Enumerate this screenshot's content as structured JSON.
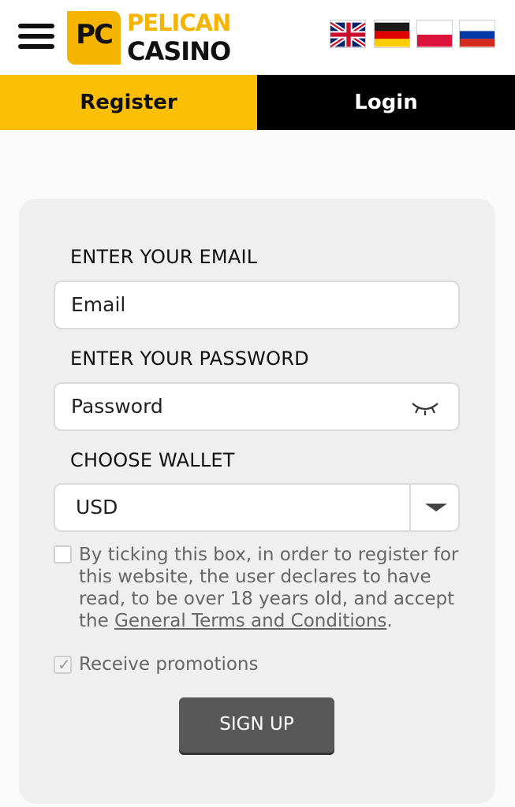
{
  "header": {
    "logo": {
      "badge": "PC",
      "line1": "PELICAN",
      "line2": "CASINO"
    },
    "flags": [
      {
        "name": "uk-flag-icon"
      },
      {
        "name": "germany-flag-icon"
      },
      {
        "name": "poland-flag-icon"
      },
      {
        "name": "russia-flag-icon"
      }
    ]
  },
  "tabs": {
    "register": "Register",
    "login": "Login"
  },
  "form": {
    "email_label": "ENTER YOUR EMAIL",
    "email_placeholder": "Email",
    "password_label": "ENTER YOUR PASSWORD",
    "password_placeholder": "Password",
    "wallet_label": "CHOOSE WALLET",
    "wallet_value": "USD",
    "terms_text": "By ticking this box, in order to register for this website, the user declares to have read, to be over 18 years old, and accept the ",
    "terms_link": "General Terms and Conditions",
    "terms_end": ".",
    "terms_checked": false,
    "promo_label": "Receive promotions",
    "promo_checked": true,
    "signup_label": "SIGN UP"
  },
  "colors": {
    "brand_yellow": "#fbbf05",
    "logo_yellow": "#f4b400",
    "tab_dark": "#000000",
    "button": "#585858"
  }
}
